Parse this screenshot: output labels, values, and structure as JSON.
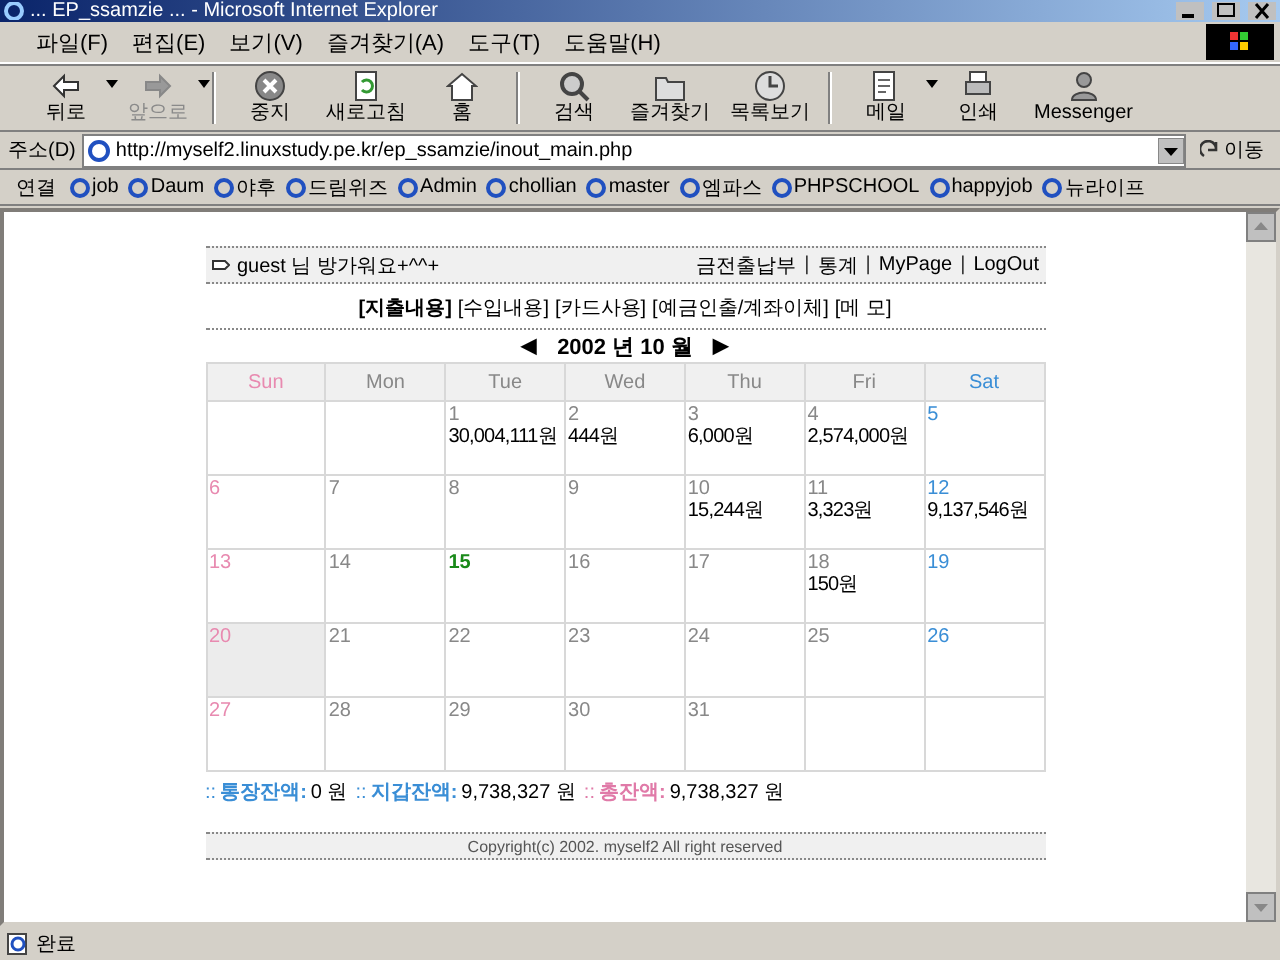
{
  "window": {
    "title": "... EP_ssamzie ... - Microsoft Internet Explorer"
  },
  "menu": [
    "파일(F)",
    "편집(E)",
    "보기(V)",
    "즐겨찾기(A)",
    "도구(T)",
    "도움말(H)"
  ],
  "toolbar": [
    {
      "label": "뒤로",
      "disabled": false,
      "dropdown": true
    },
    {
      "label": "앞으로",
      "disabled": true,
      "dropdown": true
    },
    {
      "label": "중지",
      "disabled": false,
      "dropdown": false
    },
    {
      "label": "새로고침",
      "disabled": false,
      "dropdown": false
    },
    {
      "label": "홈",
      "disabled": false,
      "dropdown": false
    },
    {
      "label": "검색",
      "disabled": false,
      "dropdown": false
    },
    {
      "label": "즐겨찾기",
      "disabled": false,
      "dropdown": false
    },
    {
      "label": "목록보기",
      "disabled": false,
      "dropdown": false
    },
    {
      "label": "메일",
      "disabled": false,
      "dropdown": true
    },
    {
      "label": "인쇄",
      "disabled": false,
      "dropdown": false
    },
    {
      "label": "Messenger",
      "disabled": false,
      "dropdown": false
    }
  ],
  "address": {
    "label": "주소(D)",
    "value": "http://myself2.linuxstudy.pe.kr/ep_ssamzie/inout_main.php",
    "go": "이동"
  },
  "links": {
    "label": "연결",
    "items": [
      "job",
      "Daum",
      "야후",
      "드림위즈",
      "Admin",
      "chollian",
      "master",
      "엠파스",
      "PHPSCHOOL",
      "happyjob",
      "뉴라이프"
    ]
  },
  "page": {
    "greeting": "guest 님 방가워요+^^+",
    "nav": [
      "금전출납부",
      "통계",
      "MyPage",
      "LogOut"
    ],
    "nav_separator": "|",
    "tabs": [
      {
        "label": "[지출내용]",
        "selected": true
      },
      {
        "label": "[수입내용]",
        "selected": false
      },
      {
        "label": "[카드사용]",
        "selected": false
      },
      {
        "label": "[예금인출/계좌이체]",
        "selected": false
      },
      {
        "label": "[메 모]",
        "selected": false
      }
    ],
    "month": {
      "prev": "◀",
      "label": "2002 년 10 월",
      "next": "▶"
    },
    "weekdays": [
      {
        "label": "Sun",
        "kind": "sun"
      },
      {
        "label": "Mon",
        "kind": "day"
      },
      {
        "label": "Tue",
        "kind": "day"
      },
      {
        "label": "Wed",
        "kind": "day"
      },
      {
        "label": "Thu",
        "kind": "day"
      },
      {
        "label": "Fri",
        "kind": "day"
      },
      {
        "label": "Sat",
        "kind": "sat"
      }
    ],
    "weeks": [
      [
        {
          "kind": "empty"
        },
        {
          "kind": "empty"
        },
        {
          "kind": "day",
          "day": "1",
          "amount": "30,004,111원",
          "today": false,
          "selected": false
        },
        {
          "kind": "day",
          "day": "2",
          "amount": "444원",
          "today": false,
          "selected": false
        },
        {
          "kind": "day",
          "day": "3",
          "amount": "6,000원",
          "today": false,
          "selected": false
        },
        {
          "kind": "day",
          "day": "4",
          "amount": "2,574,000원",
          "today": false,
          "selected": false
        },
        {
          "kind": "sat",
          "day": "5",
          "today": false,
          "selected": false
        }
      ],
      [
        {
          "kind": "sun",
          "day": "6",
          "today": false,
          "selected": false
        },
        {
          "kind": "day",
          "day": "7",
          "today": false,
          "selected": false
        },
        {
          "kind": "day",
          "day": "8",
          "today": false,
          "selected": false
        },
        {
          "kind": "day",
          "day": "9",
          "today": false,
          "selected": false
        },
        {
          "kind": "day",
          "day": "10",
          "amount": "15,244원",
          "today": false,
          "selected": false
        },
        {
          "kind": "day",
          "day": "11",
          "amount": "3,323원",
          "today": false,
          "selected": false
        },
        {
          "kind": "sat",
          "day": "12",
          "amount": "9,137,546원",
          "today": false,
          "selected": false
        }
      ],
      [
        {
          "kind": "sun",
          "day": "13",
          "today": false,
          "selected": false
        },
        {
          "kind": "day",
          "day": "14",
          "today": false,
          "selected": false
        },
        {
          "kind": "day",
          "day": "15",
          "today": true,
          "selected": false
        },
        {
          "kind": "day",
          "day": "16",
          "today": false,
          "selected": false
        },
        {
          "kind": "day",
          "day": "17",
          "today": false,
          "selected": false
        },
        {
          "kind": "day",
          "day": "18",
          "amount": "150원",
          "today": false,
          "selected": false
        },
        {
          "kind": "sat",
          "day": "19",
          "today": false,
          "selected": false
        }
      ],
      [
        {
          "kind": "sun",
          "day": "20",
          "today": false,
          "selected": true
        },
        {
          "kind": "day",
          "day": "21",
          "today": false,
          "selected": false
        },
        {
          "kind": "day",
          "day": "22",
          "today": false,
          "selected": false
        },
        {
          "kind": "day",
          "day": "23",
          "today": false,
          "selected": false
        },
        {
          "kind": "day",
          "day": "24",
          "today": false,
          "selected": false
        },
        {
          "kind": "day",
          "day": "25",
          "today": false,
          "selected": false
        },
        {
          "kind": "sat",
          "day": "26",
          "today": false,
          "selected": false
        }
      ],
      [
        {
          "kind": "sun",
          "day": "27",
          "today": false,
          "selected": false
        },
        {
          "kind": "day",
          "day": "28",
          "today": false,
          "selected": false
        },
        {
          "kind": "day",
          "day": "29",
          "today": false,
          "selected": false
        },
        {
          "kind": "day",
          "day": "30",
          "today": false,
          "selected": false
        },
        {
          "kind": "day",
          "day": "31",
          "today": false,
          "selected": false
        },
        {
          "kind": "empty"
        },
        {
          "kind": "empty"
        }
      ]
    ],
    "balances": [
      {
        "marker": "::",
        "label": "통장잔액:",
        "value": "0 원",
        "color": "#3a8ed6"
      },
      {
        "marker": "::",
        "label": "지갑잔액:",
        "value": "9,738,327 원",
        "color": "#3a8ed6"
      },
      {
        "marker": "::",
        "label": "총잔액:",
        "value": "9,738,327 원",
        "color": "#e07aa8"
      }
    ],
    "footer": "Copyright(c) 2002. myself2 All right reserved"
  },
  "status_bar": {
    "text": "완료"
  }
}
